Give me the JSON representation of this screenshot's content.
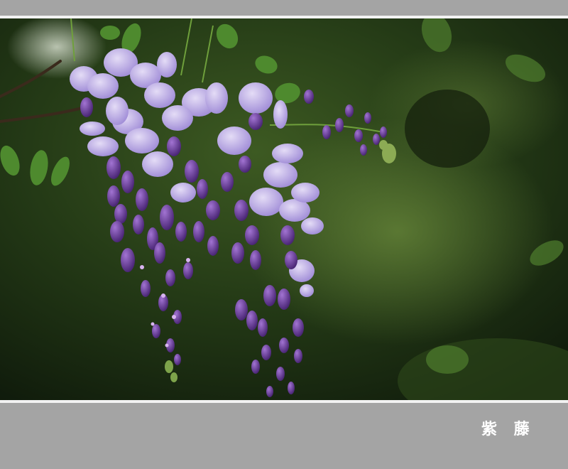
{
  "caption": "紫 藤",
  "colors": {
    "frame": "#a4a4a4",
    "rule": "#f2f2f2",
    "foliage_dark": "#1a2b12",
    "petal_light": "#b8a6e0",
    "petal_dark": "#5a2d8a"
  }
}
